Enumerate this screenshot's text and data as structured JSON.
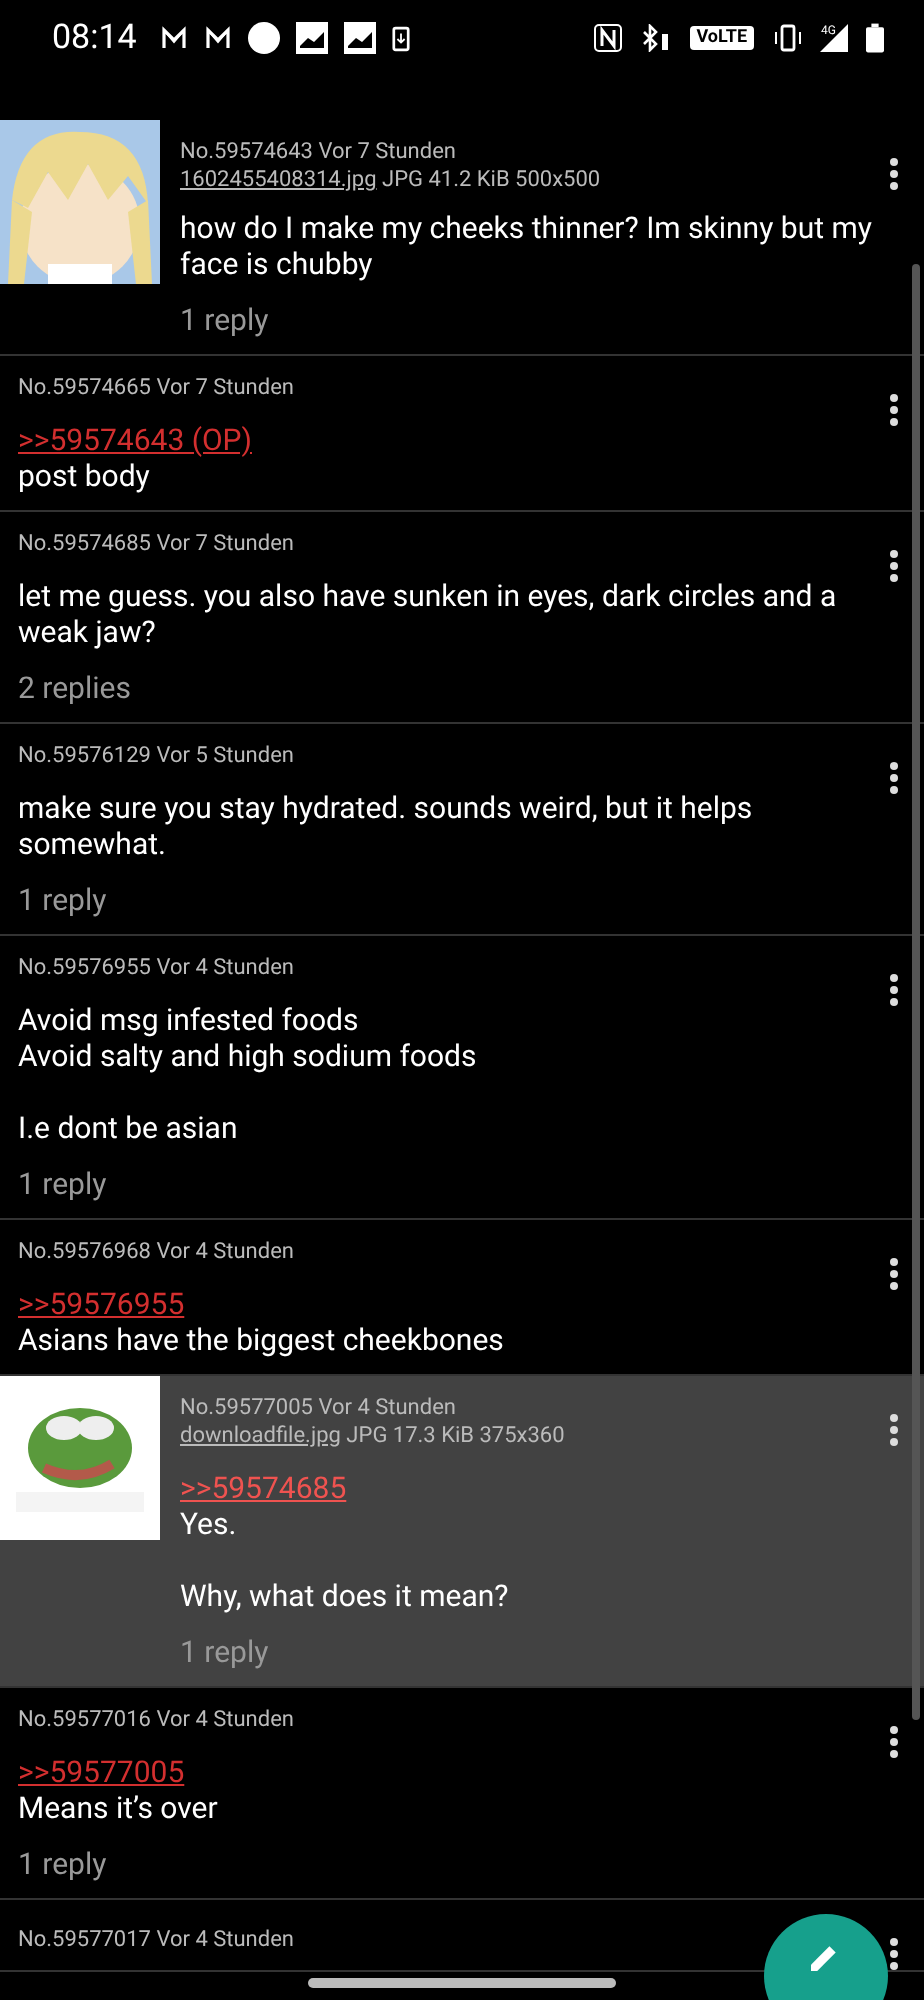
{
  "status_bar": {
    "time": "08:14",
    "volte": "VoLTE",
    "network": "4G"
  },
  "posts": [
    {
      "meta": "No.59574643 Vor 7 Stunden",
      "file": {
        "name": "1602455408314.jpg",
        "info": "JPG 41.2 KiB 500x500"
      },
      "thumbnail": {
        "kind": "picture"
      },
      "paragraphs": [
        "how do I make my cheeks thinner? Im skinny but my face is chubby"
      ],
      "replies": "1 reply",
      "highlighted": false
    },
    {
      "meta": "No.59574665 Vor 7 Stunden",
      "quote": ">>59574643 (OP)",
      "paragraphs": [
        "post body"
      ],
      "highlighted": false
    },
    {
      "meta": "No.59574685 Vor 7 Stunden",
      "paragraphs": [
        "let me guess. you also have sunken in eyes, dark circles and a weak jaw?"
      ],
      "replies": "2 replies",
      "highlighted": false
    },
    {
      "meta": "No.59576129 Vor 5 Stunden",
      "paragraphs": [
        "make sure you stay hydrated. sounds weird, but it helps somewhat."
      ],
      "replies": "1 reply",
      "highlighted": false
    },
    {
      "meta": "No.59576955 Vor 4 Stunden",
      "paragraphs": [
        "Avoid msg infested foods\nAvoid salty and high sodium foods",
        "I.e dont be asian"
      ],
      "replies": "1 reply",
      "highlighted": false
    },
    {
      "meta": "No.59576968 Vor 4 Stunden",
      "quote": ">>59576955",
      "paragraphs": [
        "Asians have the biggest cheekbones"
      ],
      "highlighted": false
    },
    {
      "meta": "No.59577005 Vor 4 Stunden",
      "file": {
        "name": "downloadfile.jpg",
        "info": "JPG 17.3 KiB 375x360"
      },
      "thumbnail": {
        "kind": "picture"
      },
      "quote": ">>59574685",
      "paragraphs": [
        "Yes.",
        "Why, what does it mean?"
      ],
      "replies": "1 reply",
      "highlighted": true
    },
    {
      "meta": "No.59577016 Vor 4 Stunden",
      "quote": ">>59577005",
      "paragraphs": [
        "Means it’s over"
      ],
      "replies": "1 reply",
      "highlighted": false
    },
    {
      "meta": "No.59577017 Vor 4 Stunden",
      "highlighted": false
    }
  ]
}
